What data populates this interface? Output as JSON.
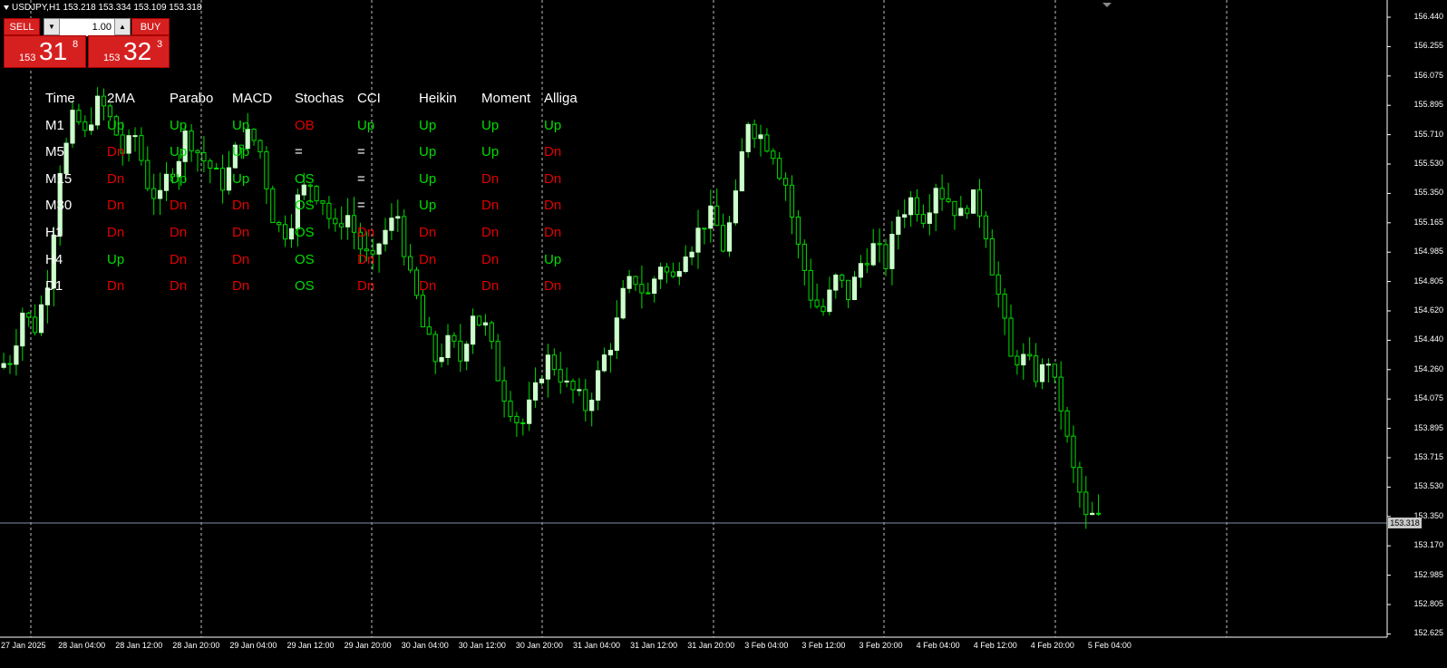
{
  "window": {
    "title": "USDJPY,H1  153.218 153.334 153.109 153.318"
  },
  "trade_panel": {
    "sell_label": "SELL",
    "buy_label": "BUY",
    "lot_value": "1.00",
    "sell_price": {
      "prefix": "153",
      "big": "31",
      "sup": "8"
    },
    "buy_price": {
      "prefix": "153",
      "big": "32",
      "sup": "3"
    }
  },
  "indicator_table": {
    "headers": [
      "Time",
      "2MA",
      "Parabo",
      "MACD",
      "Stochas",
      "CCI",
      "Heikin",
      "Moment",
      "Alliga"
    ],
    "rows": [
      {
        "tf": "M1",
        "cells": [
          "Up",
          "Up",
          "Up",
          "OB",
          "Up",
          "Up",
          "Up",
          "Up"
        ]
      },
      {
        "tf": "M5",
        "cells": [
          "Dn",
          "Up",
          "Up",
          "=",
          "=",
          "Up",
          "Up",
          "Dn"
        ]
      },
      {
        "tf": "M15",
        "cells": [
          "Dn",
          "Up",
          "Up",
          "OS",
          "=",
          "Up",
          "Dn",
          "Dn"
        ]
      },
      {
        "tf": "M30",
        "cells": [
          "Dn",
          "Dn",
          "Dn",
          "OS",
          "=",
          "Up",
          "Dn",
          "Dn"
        ]
      },
      {
        "tf": "H1",
        "cells": [
          "Dn",
          "Dn",
          "Dn",
          "OS",
          "Dn",
          "Dn",
          "Dn",
          "Dn"
        ]
      },
      {
        "tf": "H4",
        "cells": [
          "Up",
          "Dn",
          "Dn",
          "OS",
          "Dn",
          "Dn",
          "Dn",
          "Up"
        ]
      },
      {
        "tf": "D1",
        "cells": [
          "Dn",
          "Dn",
          "Dn",
          "OS",
          "Dn",
          "Dn",
          "Dn",
          "Dn"
        ]
      }
    ]
  },
  "price_axis": [
    "156.440",
    "156.255",
    "156.075",
    "155.895",
    "155.710",
    "155.530",
    "155.350",
    "155.165",
    "154.985",
    "154.805",
    "154.620",
    "154.440",
    "154.260",
    "154.075",
    "153.895",
    "153.715",
    "153.530",
    "153.350",
    "153.170",
    "152.985",
    "152.805",
    "152.625"
  ],
  "current_price": "153.318",
  "time_axis": [
    "27 Jan 2025",
    "28 Jan 04:00",
    "28 Jan 12:00",
    "28 Jan 20:00",
    "29 Jan 04:00",
    "29 Jan 12:00",
    "29 Jan 20:00",
    "30 Jan 04:00",
    "30 Jan 12:00",
    "30 Jan 20:00",
    "31 Jan 04:00",
    "31 Jan 12:00",
    "31 Jan 20:00",
    "3 Feb 04:00",
    "3 Feb 12:00",
    "3 Feb 20:00",
    "4 Feb 04:00",
    "4 Feb 12:00",
    "4 Feb 20:00",
    "5 Feb 04:00"
  ],
  "colors": {
    "background": "#000000",
    "bull_candle": "#ccffcc",
    "wick": "#00dd00",
    "up_text": "#00dd00",
    "down_text": "#e00000",
    "panel_red": "#d62020",
    "grid": "#c0c0c0"
  },
  "chart_data": {
    "type": "candlestick",
    "symbol": "USDJPY",
    "timeframe": "H1",
    "ylim": [
      152.625,
      156.44
    ],
    "last_close": 153.318,
    "series": [
      {
        "close_path": [
          154.3,
          154.6,
          154.5,
          154.8,
          155.5,
          155.8,
          155.7,
          155.9,
          155.8,
          155.6,
          155.7,
          155.4,
          155.3,
          155.5,
          155.7,
          155.6,
          155.5,
          155.4,
          155.6,
          155.7,
          155.6,
          155.2,
          155.1,
          155.3,
          155.4,
          155.3,
          155.1,
          155.2,
          155.0,
          154.9,
          155.1,
          155.2,
          154.8,
          154.5,
          154.3,
          154.4,
          154.3,
          154.6,
          154.5,
          154.2,
          154.0,
          153.9,
          154.1,
          154.3,
          154.2,
          154.1,
          154.0,
          154.2,
          154.4,
          154.7,
          154.8,
          154.7,
          154.9,
          154.8,
          155.0,
          155.1,
          155.2,
          155.0,
          155.3,
          155.8,
          155.7,
          155.6,
          155.4,
          155.0,
          154.7,
          154.6,
          154.8,
          154.7,
          154.9,
          155.0,
          154.9,
          155.2,
          155.3,
          155.2,
          155.4,
          155.3,
          155.2,
          155.3,
          155.1,
          154.7,
          154.3,
          154.3,
          154.2,
          154.3,
          154.0,
          153.6,
          153.3,
          153.3
        ]
      }
    ]
  }
}
